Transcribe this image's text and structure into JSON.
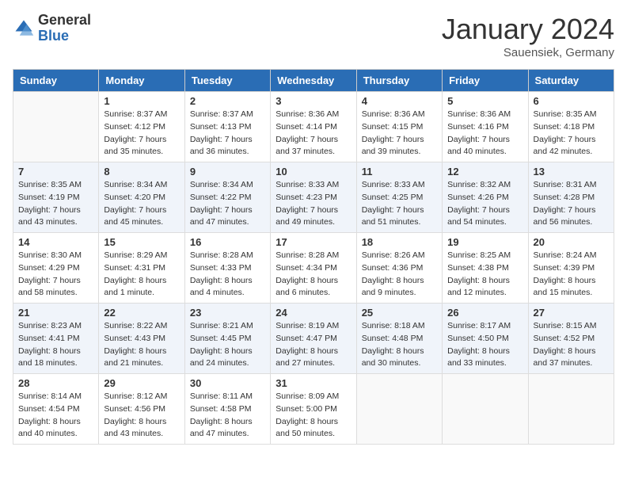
{
  "header": {
    "logo_general": "General",
    "logo_blue": "Blue",
    "month_title": "January 2024",
    "location": "Sauensiek, Germany"
  },
  "days_of_week": [
    "Sunday",
    "Monday",
    "Tuesday",
    "Wednesday",
    "Thursday",
    "Friday",
    "Saturday"
  ],
  "weeks": [
    {
      "days": [
        {
          "num": "",
          "sunrise": "",
          "sunset": "",
          "daylight": ""
        },
        {
          "num": "1",
          "sunrise": "Sunrise: 8:37 AM",
          "sunset": "Sunset: 4:12 PM",
          "daylight": "Daylight: 7 hours and 35 minutes."
        },
        {
          "num": "2",
          "sunrise": "Sunrise: 8:37 AM",
          "sunset": "Sunset: 4:13 PM",
          "daylight": "Daylight: 7 hours and 36 minutes."
        },
        {
          "num": "3",
          "sunrise": "Sunrise: 8:36 AM",
          "sunset": "Sunset: 4:14 PM",
          "daylight": "Daylight: 7 hours and 37 minutes."
        },
        {
          "num": "4",
          "sunrise": "Sunrise: 8:36 AM",
          "sunset": "Sunset: 4:15 PM",
          "daylight": "Daylight: 7 hours and 39 minutes."
        },
        {
          "num": "5",
          "sunrise": "Sunrise: 8:36 AM",
          "sunset": "Sunset: 4:16 PM",
          "daylight": "Daylight: 7 hours and 40 minutes."
        },
        {
          "num": "6",
          "sunrise": "Sunrise: 8:35 AM",
          "sunset": "Sunset: 4:18 PM",
          "daylight": "Daylight: 7 hours and 42 minutes."
        }
      ]
    },
    {
      "days": [
        {
          "num": "7",
          "sunrise": "Sunrise: 8:35 AM",
          "sunset": "Sunset: 4:19 PM",
          "daylight": "Daylight: 7 hours and 43 minutes."
        },
        {
          "num": "8",
          "sunrise": "Sunrise: 8:34 AM",
          "sunset": "Sunset: 4:20 PM",
          "daylight": "Daylight: 7 hours and 45 minutes."
        },
        {
          "num": "9",
          "sunrise": "Sunrise: 8:34 AM",
          "sunset": "Sunset: 4:22 PM",
          "daylight": "Daylight: 7 hours and 47 minutes."
        },
        {
          "num": "10",
          "sunrise": "Sunrise: 8:33 AM",
          "sunset": "Sunset: 4:23 PM",
          "daylight": "Daylight: 7 hours and 49 minutes."
        },
        {
          "num": "11",
          "sunrise": "Sunrise: 8:33 AM",
          "sunset": "Sunset: 4:25 PM",
          "daylight": "Daylight: 7 hours and 51 minutes."
        },
        {
          "num": "12",
          "sunrise": "Sunrise: 8:32 AM",
          "sunset": "Sunset: 4:26 PM",
          "daylight": "Daylight: 7 hours and 54 minutes."
        },
        {
          "num": "13",
          "sunrise": "Sunrise: 8:31 AM",
          "sunset": "Sunset: 4:28 PM",
          "daylight": "Daylight: 7 hours and 56 minutes."
        }
      ]
    },
    {
      "days": [
        {
          "num": "14",
          "sunrise": "Sunrise: 8:30 AM",
          "sunset": "Sunset: 4:29 PM",
          "daylight": "Daylight: 7 hours and 58 minutes."
        },
        {
          "num": "15",
          "sunrise": "Sunrise: 8:29 AM",
          "sunset": "Sunset: 4:31 PM",
          "daylight": "Daylight: 8 hours and 1 minute."
        },
        {
          "num": "16",
          "sunrise": "Sunrise: 8:28 AM",
          "sunset": "Sunset: 4:33 PM",
          "daylight": "Daylight: 8 hours and 4 minutes."
        },
        {
          "num": "17",
          "sunrise": "Sunrise: 8:28 AM",
          "sunset": "Sunset: 4:34 PM",
          "daylight": "Daylight: 8 hours and 6 minutes."
        },
        {
          "num": "18",
          "sunrise": "Sunrise: 8:26 AM",
          "sunset": "Sunset: 4:36 PM",
          "daylight": "Daylight: 8 hours and 9 minutes."
        },
        {
          "num": "19",
          "sunrise": "Sunrise: 8:25 AM",
          "sunset": "Sunset: 4:38 PM",
          "daylight": "Daylight: 8 hours and 12 minutes."
        },
        {
          "num": "20",
          "sunrise": "Sunrise: 8:24 AM",
          "sunset": "Sunset: 4:39 PM",
          "daylight": "Daylight: 8 hours and 15 minutes."
        }
      ]
    },
    {
      "days": [
        {
          "num": "21",
          "sunrise": "Sunrise: 8:23 AM",
          "sunset": "Sunset: 4:41 PM",
          "daylight": "Daylight: 8 hours and 18 minutes."
        },
        {
          "num": "22",
          "sunrise": "Sunrise: 8:22 AM",
          "sunset": "Sunset: 4:43 PM",
          "daylight": "Daylight: 8 hours and 21 minutes."
        },
        {
          "num": "23",
          "sunrise": "Sunrise: 8:21 AM",
          "sunset": "Sunset: 4:45 PM",
          "daylight": "Daylight: 8 hours and 24 minutes."
        },
        {
          "num": "24",
          "sunrise": "Sunrise: 8:19 AM",
          "sunset": "Sunset: 4:47 PM",
          "daylight": "Daylight: 8 hours and 27 minutes."
        },
        {
          "num": "25",
          "sunrise": "Sunrise: 8:18 AM",
          "sunset": "Sunset: 4:48 PM",
          "daylight": "Daylight: 8 hours and 30 minutes."
        },
        {
          "num": "26",
          "sunrise": "Sunrise: 8:17 AM",
          "sunset": "Sunset: 4:50 PM",
          "daylight": "Daylight: 8 hours and 33 minutes."
        },
        {
          "num": "27",
          "sunrise": "Sunrise: 8:15 AM",
          "sunset": "Sunset: 4:52 PM",
          "daylight": "Daylight: 8 hours and 37 minutes."
        }
      ]
    },
    {
      "days": [
        {
          "num": "28",
          "sunrise": "Sunrise: 8:14 AM",
          "sunset": "Sunset: 4:54 PM",
          "daylight": "Daylight: 8 hours and 40 minutes."
        },
        {
          "num": "29",
          "sunrise": "Sunrise: 8:12 AM",
          "sunset": "Sunset: 4:56 PM",
          "daylight": "Daylight: 8 hours and 43 minutes."
        },
        {
          "num": "30",
          "sunrise": "Sunrise: 8:11 AM",
          "sunset": "Sunset: 4:58 PM",
          "daylight": "Daylight: 8 hours and 47 minutes."
        },
        {
          "num": "31",
          "sunrise": "Sunrise: 8:09 AM",
          "sunset": "Sunset: 5:00 PM",
          "daylight": "Daylight: 8 hours and 50 minutes."
        },
        {
          "num": "",
          "sunrise": "",
          "sunset": "",
          "daylight": ""
        },
        {
          "num": "",
          "sunrise": "",
          "sunset": "",
          "daylight": ""
        },
        {
          "num": "",
          "sunrise": "",
          "sunset": "",
          "daylight": ""
        }
      ]
    }
  ]
}
